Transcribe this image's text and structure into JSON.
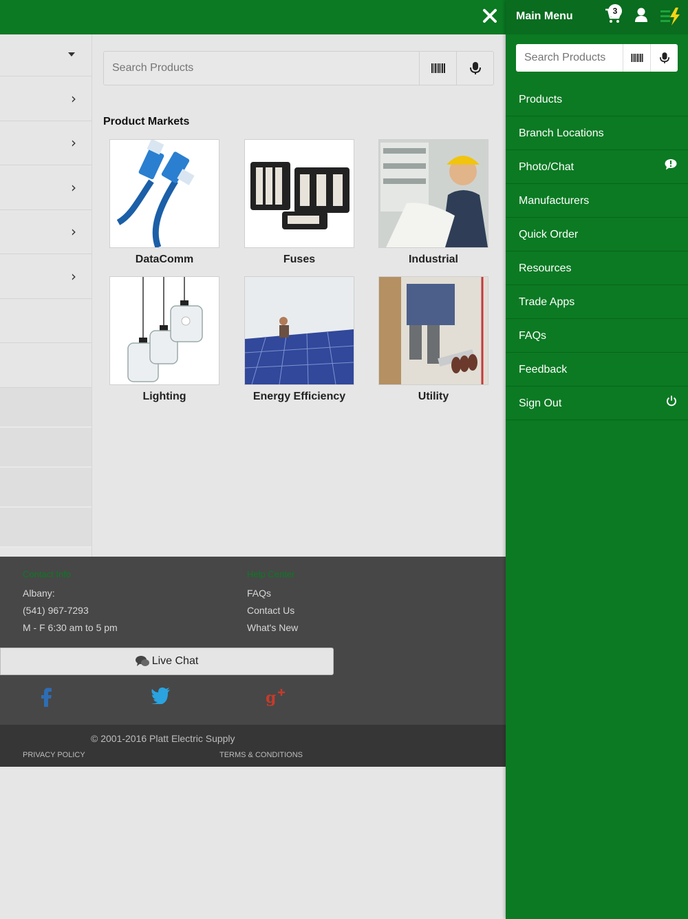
{
  "main": {
    "search_placeholder": "Search Products",
    "markets_title": "Product Markets",
    "markets": [
      {
        "label": "DataComm"
      },
      {
        "label": "Fuses"
      },
      {
        "label": "Industrial"
      },
      {
        "label": "Lighting"
      },
      {
        "label": "Energy Efficiency"
      },
      {
        "label": "Utility"
      }
    ]
  },
  "footer": {
    "contact_heading": "Contact Info",
    "help_heading": "Help Center",
    "contact_lines": [
      "Albany:",
      "(541) 967-7293",
      "M - F 6:30 am to 5 pm"
    ],
    "help_lines": [
      "FAQs",
      "Contact Us",
      "What's New"
    ],
    "live_chat": "Live Chat",
    "copyright": "© 2001-2016 Platt Electric Supply",
    "privacy": "PRIVACY POLICY",
    "terms": "TERMS & CONDITIONS"
  },
  "menu": {
    "title": "Main Menu",
    "cart_count": "3",
    "search_placeholder": "Search Products",
    "items": [
      {
        "label": "Products"
      },
      {
        "label": "Branch Locations"
      },
      {
        "label": "Photo/Chat"
      },
      {
        "label": "Manufacturers"
      },
      {
        "label": "Quick Order"
      },
      {
        "label": "Resources"
      },
      {
        "label": "Trade Apps"
      },
      {
        "label": "FAQs"
      },
      {
        "label": "Feedback"
      },
      {
        "label": "Sign Out"
      }
    ]
  },
  "colors": {
    "brand_green": "#0b7a23",
    "footer_bg": "#474747",
    "accent_yellow": "#f5d415"
  }
}
